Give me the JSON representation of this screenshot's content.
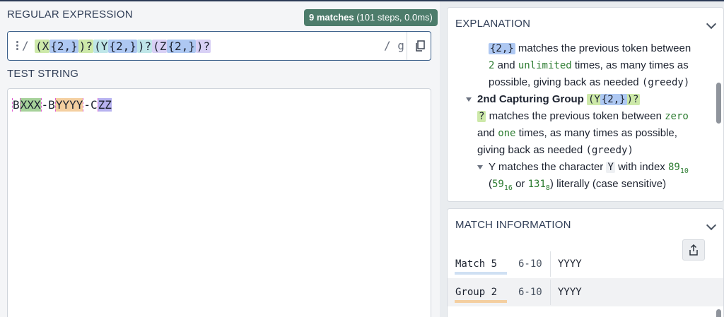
{
  "regex": {
    "title": "REGULAR EXPRESSION",
    "match_count": "9 matches",
    "match_detail": "(101 steps, 0.0ms)",
    "delimiter_open": "/",
    "delimiter_close": "/ g",
    "tokens": [
      "(X",
      "{2,}",
      ")?",
      "(Y",
      "{2,}",
      ")?",
      "(Z",
      "{2,}",
      ")?"
    ]
  },
  "test": {
    "title": "TEST STRING",
    "segments": [
      "B",
      "XXX",
      "-B",
      "YYYY",
      "-C",
      "ZZ"
    ]
  },
  "explanation": {
    "title": "EXPLANATION",
    "l1_chip": "{2,}",
    "l1_text": " matches the previous token between",
    "l2_num": "2",
    "l2_mid": " and ",
    "l2_kw": "unlimited",
    "l2_rest": " times, as many times as",
    "l3_text": "possible, giving back as needed ",
    "l3_kw": "(greedy)",
    "group2_label": "2nd Capturing Group",
    "group2_open": "(Y",
    "group2_chip": "{2,}",
    "group2_close": ")?",
    "l5_chip": "?",
    "l5_text": " matches the previous token between ",
    "l5_kw": "zero",
    "l6_a": "and ",
    "l6_kw": "one",
    "l6_b": " times, as many times as possible,",
    "l7_text": "giving back as needed ",
    "l7_kw": "(greedy)",
    "l8_a": "Y matches the character ",
    "l8_chip": "Y",
    "l8_b": " with index ",
    "l8_num": "89",
    "l8_sub": "10",
    "l9_open": "(",
    "l9_num1": "59",
    "l9_sub1": "16",
    "l9_or": " or ",
    "l9_num2": "131",
    "l9_sub2": "8",
    "l9_rest": ") literally (case sensitive)"
  },
  "match_info": {
    "title": "MATCH INFORMATION",
    "rows": [
      {
        "label": "Match 5",
        "range": "6-10",
        "value": "YYYY",
        "color": "#cfe0f3"
      },
      {
        "label": "Group 2",
        "range": "6-10",
        "value": "YYYY",
        "color": "#f4cfa0"
      }
    ]
  },
  "icons": [
    "drag-handle-icon",
    "copy-icon",
    "chevron-down-icon",
    "expand-triangle-icon",
    "share-icon"
  ]
}
